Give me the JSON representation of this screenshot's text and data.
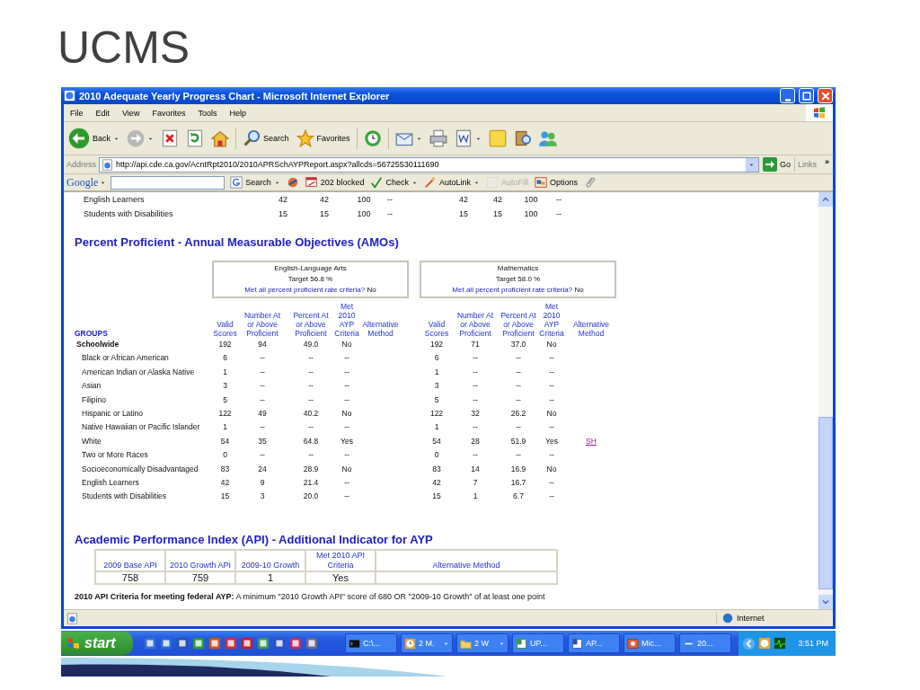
{
  "slide": {
    "title": "UCMS"
  },
  "window": {
    "title": "2010 Adequate Yearly Progress Chart - Microsoft Internet Explorer",
    "menu": [
      "File",
      "Edit",
      "View",
      "Favorites",
      "Tools",
      "Help"
    ],
    "toolbar": [
      {
        "label": "Back",
        "dropdown": true
      },
      {
        "dropdown": true
      },
      {
        "dropdown": false
      },
      {
        "dropdown": false
      },
      {
        "dropdown": false
      },
      {
        "label": "Search",
        "dropdown": false
      },
      {
        "label": "Favorites",
        "dropdown": false
      },
      {
        "dropdown": false
      },
      {
        "dropdown": true
      },
      {
        "dropdown": false
      },
      {
        "dropdown": true
      },
      {
        "dropdown": false
      },
      {
        "dropdown": false
      },
      {
        "dropdown": false
      }
    ],
    "address": {
      "label": "Address",
      "url": "http://api.cde.ca.gov/AcntRpt2010/2010APRSchAYPReport.aspx?allcds=56725530111690",
      "go": "Go",
      "links": "Links",
      "chevron": "»"
    },
    "google_bar": {
      "logo": "Google",
      "items": [
        {
          "label": "Search",
          "dropdown": true,
          "disabled": false
        },
        {
          "dropdown": false,
          "disabled": false
        },
        {
          "label": "202 blocked",
          "dropdown": false,
          "disabled": false
        },
        {
          "label": "Check",
          "dropdown": true,
          "disabled": false
        },
        {
          "label": "AutoLink",
          "dropdown": true,
          "disabled": false
        },
        {
          "label": "AutoFill",
          "dropdown": false,
          "disabled": true
        },
        {
          "label": "Options",
          "dropdown": false,
          "disabled": false
        },
        {
          "dropdown": false,
          "disabled": false
        }
      ]
    },
    "status_bar": {
      "zone": "Internet"
    }
  },
  "page": {
    "previous_rows": [
      {
        "group": "English Learners",
        "ela": [
          "42",
          "42",
          "100",
          "--"
        ],
        "math": [
          "42",
          "42",
          "100",
          "--"
        ]
      },
      {
        "group": "Students with Disabilities",
        "ela": [
          "15",
          "15",
          "100",
          "--"
        ],
        "math": [
          "15",
          "15",
          "100",
          "--"
        ]
      }
    ],
    "amo": {
      "heading": "Percent Proficient - Annual Measurable Objectives (AMOs)",
      "subjects": [
        {
          "name": "English-Language Arts",
          "target": "Target  56.8 %",
          "criteria_question": "Met all percent proficient rate criteria?",
          "criteria_answer": "No",
          "columns": [
            "Valid Scores",
            "Number At or Above Proficient",
            "Percent At or Above Proficient",
            "Met 2010 AYP Criteria",
            "Alternative Method"
          ]
        },
        {
          "name": "Mathematics",
          "target": "Target  58.0 %",
          "criteria_question": "Met all percent proficient rate criteria?",
          "criteria_answer": "No",
          "columns": [
            "Valid Scores",
            "Number At or Above Proficient",
            "Percent At or Above Proficient",
            "Met 2010 AYP Criteria",
            "Alternative Method"
          ]
        }
      ],
      "groups_header": "GROUPS",
      "rows": [
        {
          "kind": "total",
          "group": "Schoolwide",
          "ela": {
            "valid": "192",
            "number": "94",
            "percent": "49.0",
            "met": "No"
          },
          "math": {
            "valid": "192",
            "number": "71",
            "percent": "37.0",
            "met": "No"
          }
        },
        {
          "kind": "group",
          "group": "Black or African American",
          "ela": {
            "valid": "6",
            "number": "--",
            "percent": "--",
            "met": "--"
          },
          "math": {
            "valid": "6",
            "number": "--",
            "percent": "--",
            "met": "--"
          }
        },
        {
          "kind": "group",
          "group": "American Indian or Alaska Native",
          "ela": {
            "valid": "1",
            "number": "--",
            "percent": "--",
            "met": "--"
          },
          "math": {
            "valid": "1",
            "number": "--",
            "percent": "--",
            "met": "--"
          }
        },
        {
          "kind": "group",
          "group": "Asian",
          "ela": {
            "valid": "3",
            "number": "--",
            "percent": "--",
            "met": "--"
          },
          "math": {
            "valid": "3",
            "number": "--",
            "percent": "--",
            "met": "--"
          }
        },
        {
          "kind": "group",
          "group": "Filipino",
          "ela": {
            "valid": "5",
            "number": "--",
            "percent": "--",
            "met": "--"
          },
          "math": {
            "valid": "5",
            "number": "--",
            "percent": "--",
            "met": "--"
          }
        },
        {
          "kind": "group",
          "group": "Hispanic or Latino",
          "ela": {
            "valid": "122",
            "number": "49",
            "percent": "40.2",
            "met": "No"
          },
          "math": {
            "valid": "122",
            "number": "32",
            "percent": "26.2",
            "met": "No"
          }
        },
        {
          "kind": "group",
          "group": "Native Hawaiian or Pacific Islander",
          "ela": {
            "valid": "1",
            "number": "--",
            "percent": "--",
            "met": "--"
          },
          "math": {
            "valid": "1",
            "number": "--",
            "percent": "--",
            "met": "--"
          }
        },
        {
          "kind": "group",
          "group": "White",
          "ela": {
            "valid": "54",
            "number": "35",
            "percent": "64.8",
            "met": "Yes"
          },
          "math": {
            "valid": "54",
            "number": "28",
            "percent": "51.9",
            "met": "Yes",
            "alternative": "SH"
          }
        },
        {
          "kind": "group",
          "group": "Two or More Races",
          "ela": {
            "valid": "0",
            "number": "--",
            "percent": "--",
            "met": "--"
          },
          "math": {
            "valid": "0",
            "number": "--",
            "percent": "--",
            "met": "--"
          }
        },
        {
          "kind": "group",
          "group": "Socioeconomically Disadvantaged",
          "ela": {
            "valid": "83",
            "number": "24",
            "percent": "28.9",
            "met": "No"
          },
          "math": {
            "valid": "83",
            "number": "14",
            "percent": "16.9",
            "met": "No"
          }
        },
        {
          "kind": "group",
          "group": "English Learners",
          "ela": {
            "valid": "42",
            "number": "9",
            "percent": "21.4",
            "met": "--"
          },
          "math": {
            "valid": "42",
            "number": "7",
            "percent": "16.7",
            "met": "--"
          }
        },
        {
          "kind": "group",
          "group": "Students with Disabilities",
          "ela": {
            "valid": "15",
            "number": "3",
            "percent": "20.0",
            "met": "--"
          },
          "math": {
            "valid": "15",
            "number": "1",
            "percent": "6.7",
            "met": "--"
          }
        }
      ]
    },
    "api": {
      "heading": "Academic Performance Index (API) - Additional Indicator for AYP",
      "columns": [
        "2009 Base API",
        "2010 Growth API",
        "2009-10 Growth",
        "Met 2010 API Criteria",
        "Alternative Method"
      ],
      "values": [
        "758",
        "759",
        "1",
        "Yes"
      ],
      "note": "**2010 API Criteria for meeting federal AYP:** A minimum \"2010 Growth API\" score of 680 OR \"2009-10 Growth\" of at least one point"
    }
  },
  "taskbar": {
    "start": "start",
    "tasks": [
      {
        "label": "C:\\...",
        "dropdown": false
      },
      {
        "label": "2 M.",
        "dropdown": true
      },
      {
        "label": "2 W",
        "dropdown": true
      },
      {
        "label": "UP...",
        "dropdown": false
      },
      {
        "label": "AP...",
        "dropdown": false
      },
      {
        "label": "Mic...",
        "dropdown": false
      },
      {
        "label": "20...",
        "dropdown": false
      }
    ],
    "clock": "3:51 PM"
  }
}
